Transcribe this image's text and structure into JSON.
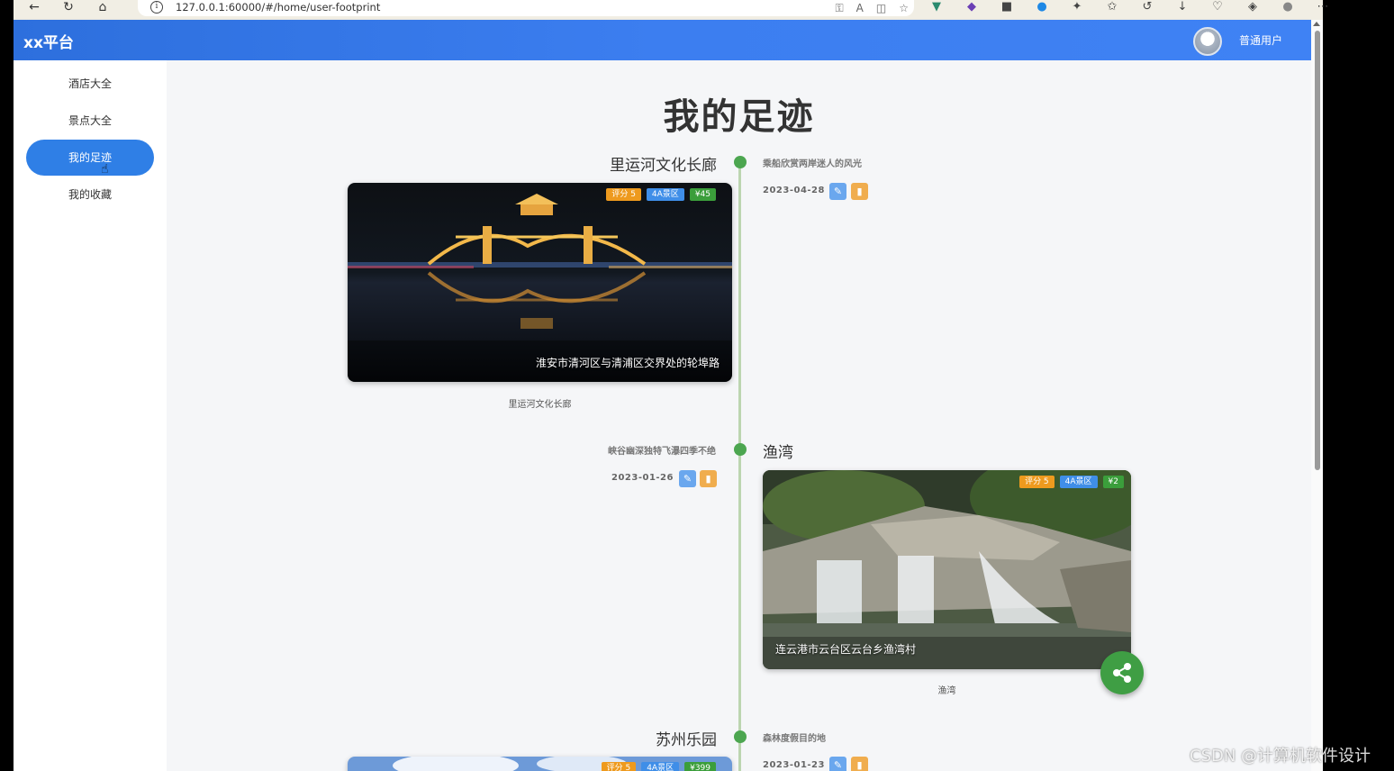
{
  "browser": {
    "url": "127.0.0.1:60000/#/home/user-footprint"
  },
  "header": {
    "brand": "xx平台",
    "username": "普通用户"
  },
  "sidebar": {
    "items": [
      {
        "label": "酒店大全",
        "active": false
      },
      {
        "label": "景点大全",
        "active": false
      },
      {
        "label": "我的足迹",
        "active": true
      },
      {
        "label": "我的收藏",
        "active": false
      }
    ]
  },
  "main": {
    "title": "我的足迹",
    "footprints": [
      {
        "name": "里运河文化长廊",
        "desc": "乘船欣赏两岸迷人的风光",
        "date": "2023-04-28",
        "rating": "评分 5",
        "level": "4A景区",
        "price": "¥45",
        "address": "淮安市清河区与清浦区交界处的轮埠路",
        "caption": "里运河文化长廊"
      },
      {
        "name": "渔湾",
        "desc": "峡谷幽深独特飞瀑四季不绝",
        "date": "2023-01-26",
        "rating": "评分 5",
        "level": "4A景区",
        "price": "¥2",
        "address": "连云港市云台区云台乡渔湾村",
        "caption": "渔湾"
      },
      {
        "name": "苏州乐园",
        "desc": "森林度假目的地",
        "date": "2023-01-23",
        "rating": "评分 5",
        "level": "4A景区",
        "price": "¥399"
      }
    ]
  },
  "watermark": "CSDN @计算机软件设计",
  "colors": {
    "header": "#3c7ef0",
    "active_nav": "#2f7fe6",
    "timeline_dot": "#4ca650",
    "fab": "#3f9e44"
  }
}
